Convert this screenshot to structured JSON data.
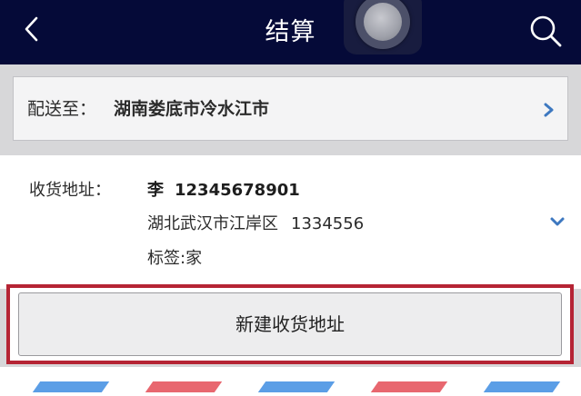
{
  "navbar": {
    "title": "结算",
    "back_icon": "chevron-left-icon",
    "search_icon": "search-icon",
    "background_color": "#050a38"
  },
  "delivery": {
    "label": "配送至：",
    "value": "湖南娄底市冷水江市",
    "chevron_icon": "chevron-right-icon",
    "chevron_color": "#3d78c0"
  },
  "address": {
    "label": "收货地址：",
    "name": "李",
    "phone": "12345678901",
    "detail": "湖北武汉市江岸区",
    "zip": "1334556",
    "tag": "标签:家",
    "chevron_icon": "chevron-down-icon"
  },
  "actions": {
    "new_address_label": "新建收货地址",
    "highlight_color": "#b52434"
  },
  "stripe_colors": [
    "#5b9ee6",
    "#e8676f"
  ]
}
